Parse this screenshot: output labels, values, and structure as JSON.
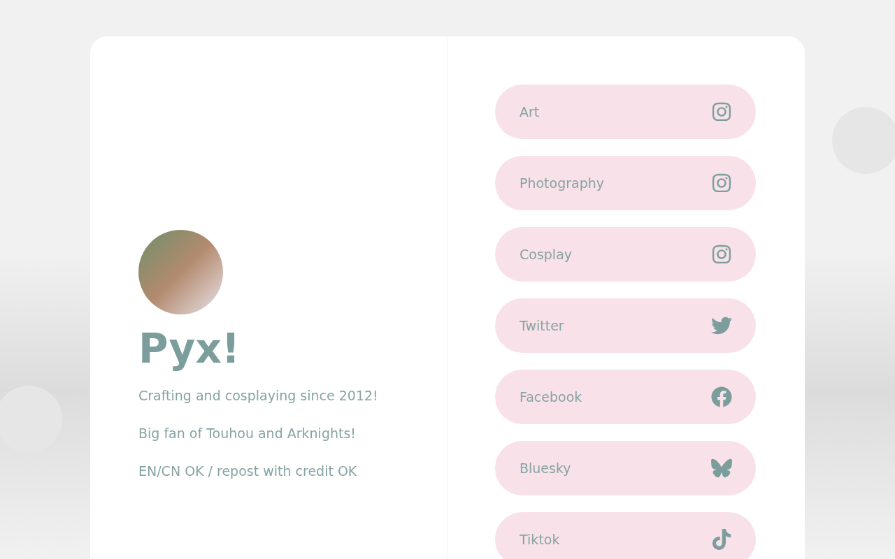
{
  "profile": {
    "name": "Pyx!",
    "bio": [
      "Crafting and cosplaying since 2012!",
      "Big fan of Touhou and Arknights!",
      "EN/CN OK / repost with credit OK"
    ]
  },
  "links": [
    {
      "label": "Art",
      "kind": "instagram"
    },
    {
      "label": "Photography",
      "kind": "instagram"
    },
    {
      "label": "Cosplay",
      "kind": "instagram"
    },
    {
      "label": "Twitter",
      "kind": "twitter"
    },
    {
      "label": "Facebook",
      "kind": "facebook"
    },
    {
      "label": "Bluesky",
      "kind": "bluesky"
    },
    {
      "label": "Tiktok",
      "kind": "tiktok"
    }
  ]
}
